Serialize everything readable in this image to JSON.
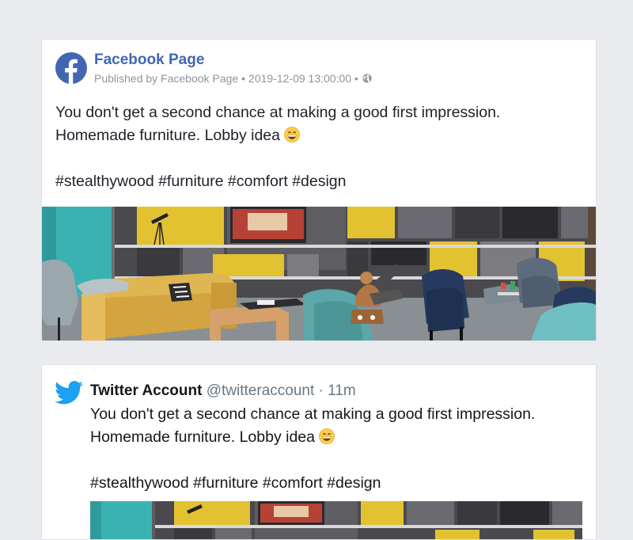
{
  "facebook_post": {
    "page_name": "Facebook Page",
    "published_by": "Published by Facebook Page",
    "separator": "•",
    "timestamp": "2019-12-09 13:00:00",
    "audience_icon": "globe-icon",
    "text_line1": "You don't get a second chance at making a good first impression.",
    "text_line2": "Homemade furniture. Lobby idea",
    "hashtags": "#stealthywood #furniture #comfort #design",
    "emoji": "grinning-face-emoji",
    "logo_icon": "facebook-logo-icon",
    "image_alt": "lobby-photo"
  },
  "twitter_post": {
    "account_name": "Twitter Account",
    "handle": "@twitteraccount",
    "separator": "·",
    "relative_time": "11m",
    "text_line1": "You don't get a second chance at making a good first impression.",
    "text_line2": "Homemade furniture. Lobby idea",
    "hashtags": "#stealthywood #furniture #comfort #design",
    "emoji": "grinning-face-emoji",
    "logo_icon": "twitter-bird-icon",
    "image_alt": "lobby-photo"
  },
  "colors": {
    "page_background": "#e9ebee",
    "facebook_blue": "#4267b2",
    "facebook_meta_gray": "#90949c",
    "twitter_blue": "#1da1f2",
    "twitter_handle_gray": "#657786"
  }
}
